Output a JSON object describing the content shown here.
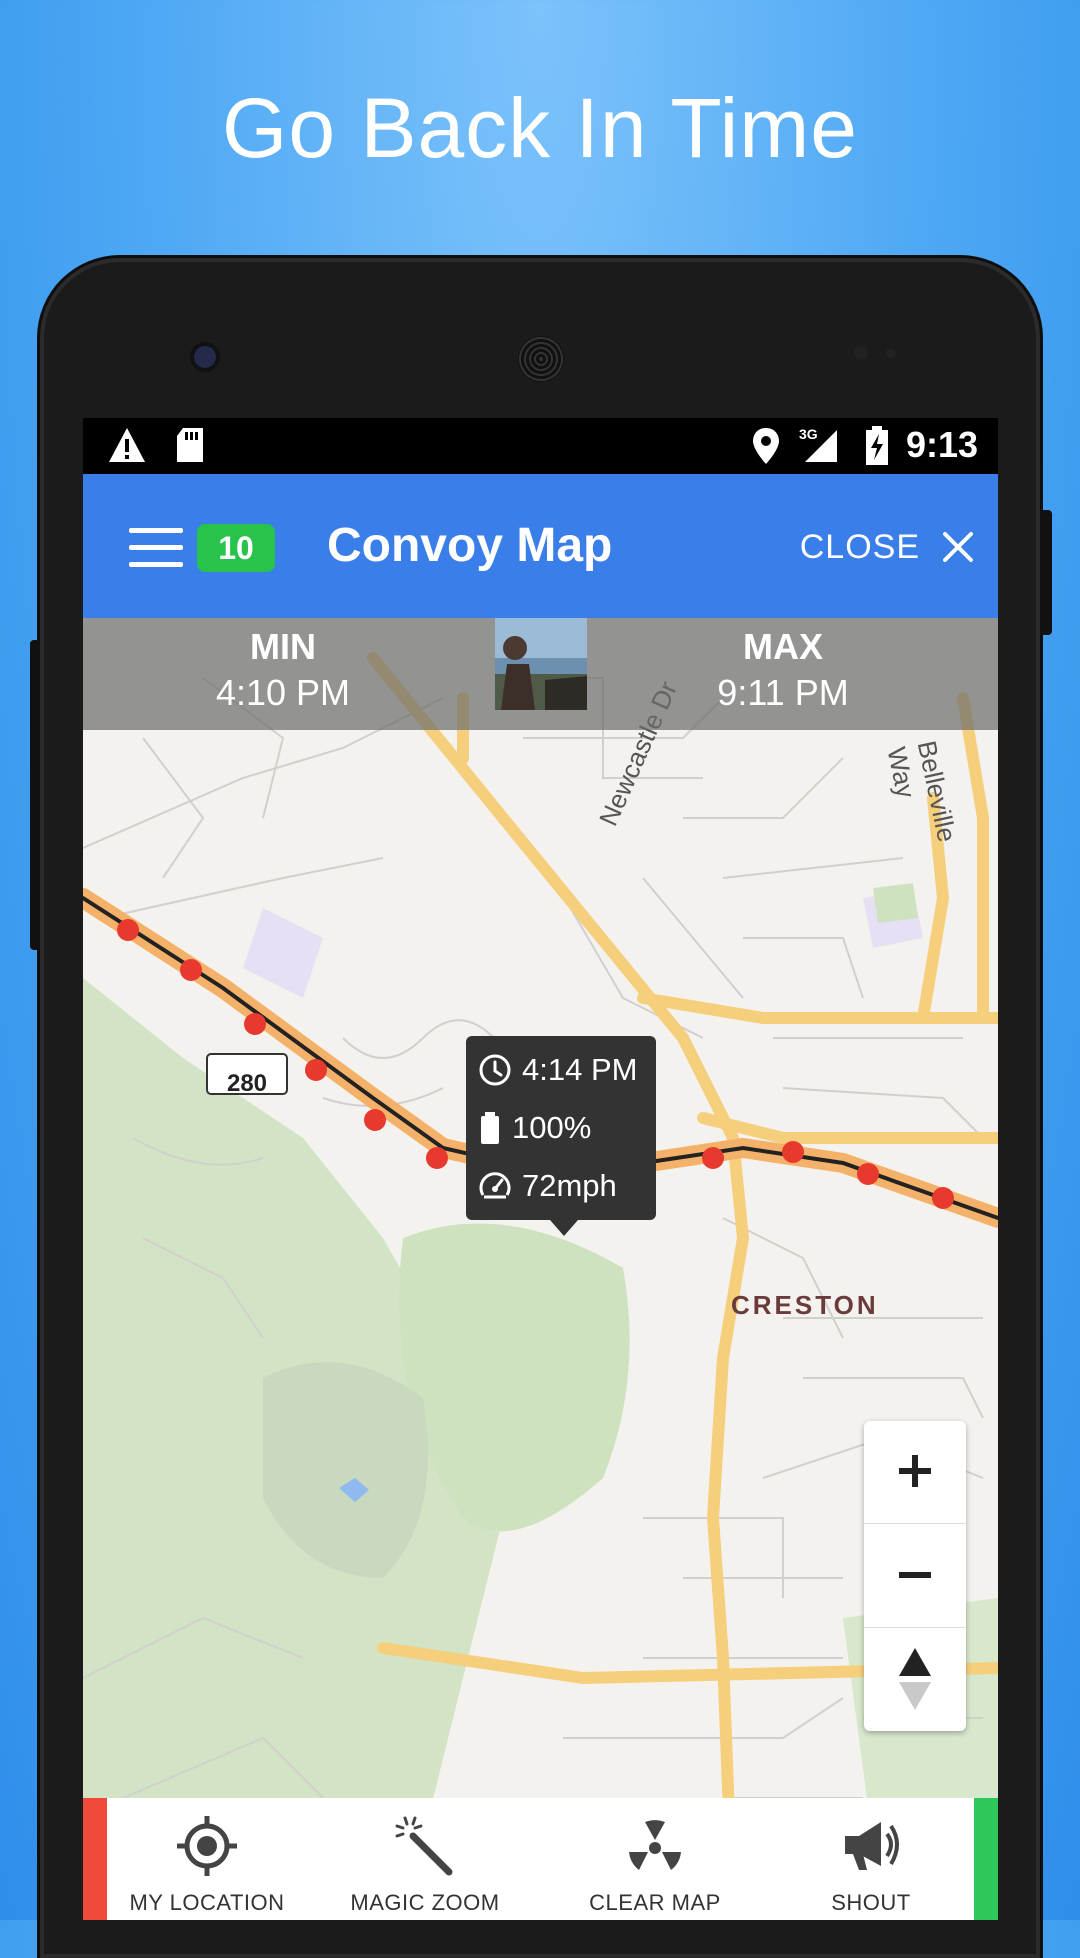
{
  "headline": "Go Back In Time",
  "status_bar": {
    "network": "3G",
    "time": "9:13",
    "icons": [
      "warning-icon",
      "sd-card-icon",
      "location-pin-icon",
      "signal-icon",
      "battery-charging-icon"
    ]
  },
  "app_bar": {
    "badge_count": "10",
    "title": "Convoy Map",
    "close_label": "CLOSE",
    "colors": {
      "bar": "#3a7ee9",
      "badge": "#27c34a"
    }
  },
  "time_range": {
    "min_label": "MIN",
    "min_value": "4:10 PM",
    "max_label": "MAX",
    "max_value": "9:11 PM"
  },
  "map": {
    "highway_shield": "280",
    "place_label": "CRESTON",
    "street_labels": [
      "Newcastle Dr",
      "Belleville Way"
    ],
    "route_color": "#e8392f"
  },
  "tooltip": {
    "time": "4:14 PM",
    "battery": "100%",
    "speed": "72mph"
  },
  "bottom_nav": [
    {
      "label": "MY LOCATION",
      "icon": "crosshair-icon"
    },
    {
      "label": "MAGIC ZOOM",
      "icon": "magic-wand-icon"
    },
    {
      "label": "CLEAR MAP",
      "icon": "radiation-icon"
    },
    {
      "label": "SHOUT",
      "icon": "megaphone-icon"
    }
  ]
}
